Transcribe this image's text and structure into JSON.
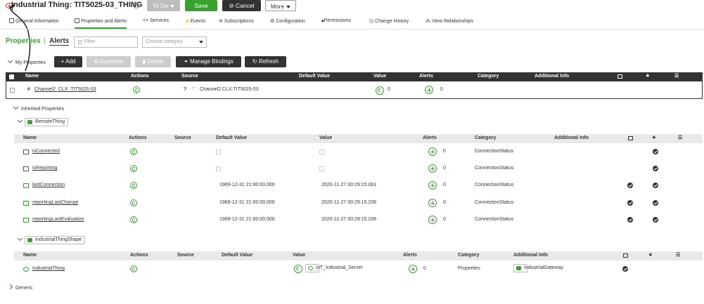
{
  "header": {
    "title": "Industrial Thing: TIT5025-03_THING",
    "todo": "To Do",
    "save": "Save",
    "cancel": "Cancel",
    "more": "More"
  },
  "tabs": [
    "General Information",
    "Properties and Alerts",
    "Services",
    "Events",
    "Subscriptions",
    "Configuration",
    "Permissions",
    "Change History",
    "View Relationships"
  ],
  "section": {
    "properties": "Properties",
    "separator": "|",
    "alerts": "Alerts",
    "filter_placeholder": "Filter",
    "category_placeholder": "Choose category"
  },
  "my_properties": {
    "label": "My Properties",
    "add": "Add",
    "duplicate": "Duplicate",
    "delete": "Delete",
    "manage_bindings": "Manage Bindings",
    "refresh": "Refresh"
  },
  "table_headers": {
    "name": "Name",
    "actions": "Actions",
    "source": "Source",
    "default_value": "Default Value",
    "value": "Value",
    "alerts": "Alerts",
    "category": "Category",
    "additional_info": "Additional Info"
  },
  "my_row": {
    "name": "Channel2_CLX_TIT5025-03",
    "source": "Channel2.CLX.TIT5025-03",
    "value": "0",
    "alerts": "0"
  },
  "inherited": {
    "label": "Inherited Properties",
    "remote_thing": "RemoteThing",
    "industrial_thing_shape": "IndustrialThingShape",
    "generic": "Generic"
  },
  "remote_rows": [
    {
      "name": "isConnected",
      "default": "",
      "value": "",
      "alerts": "0",
      "category": "ConnectionStatus"
    },
    {
      "name": "isReporting",
      "default": "",
      "value": "",
      "alerts": "0",
      "category": "ConnectionStatus"
    },
    {
      "name": "lastConnection",
      "default": "1969-12-31 21:00:00.000",
      "value": "2020-11-27 00:29:15.061",
      "alerts": "0",
      "category": "ConnectionStatus"
    },
    {
      "name": "reportingLastChange",
      "default": "1969-12-31 21:00:00.000",
      "value": "2020-11-27 00:29:15.206",
      "alerts": "0",
      "category": "ConnectionStatus"
    },
    {
      "name": "reportingLastEvaluation",
      "default": "1969-12-31 21:00:00.000",
      "value": "2020-11-27 00:29:15.206",
      "alerts": "0",
      "category": "ConnectionStatus"
    }
  ],
  "shape_row": {
    "name": "IndustrialThing",
    "value": "IoT_Industrial_Server",
    "alerts": "0",
    "category": "Properties",
    "additional_info": "IndustrialGateway"
  },
  "colors": {
    "brand": "#37a32e",
    "dark": "#333333",
    "danger": "#c0392b"
  }
}
